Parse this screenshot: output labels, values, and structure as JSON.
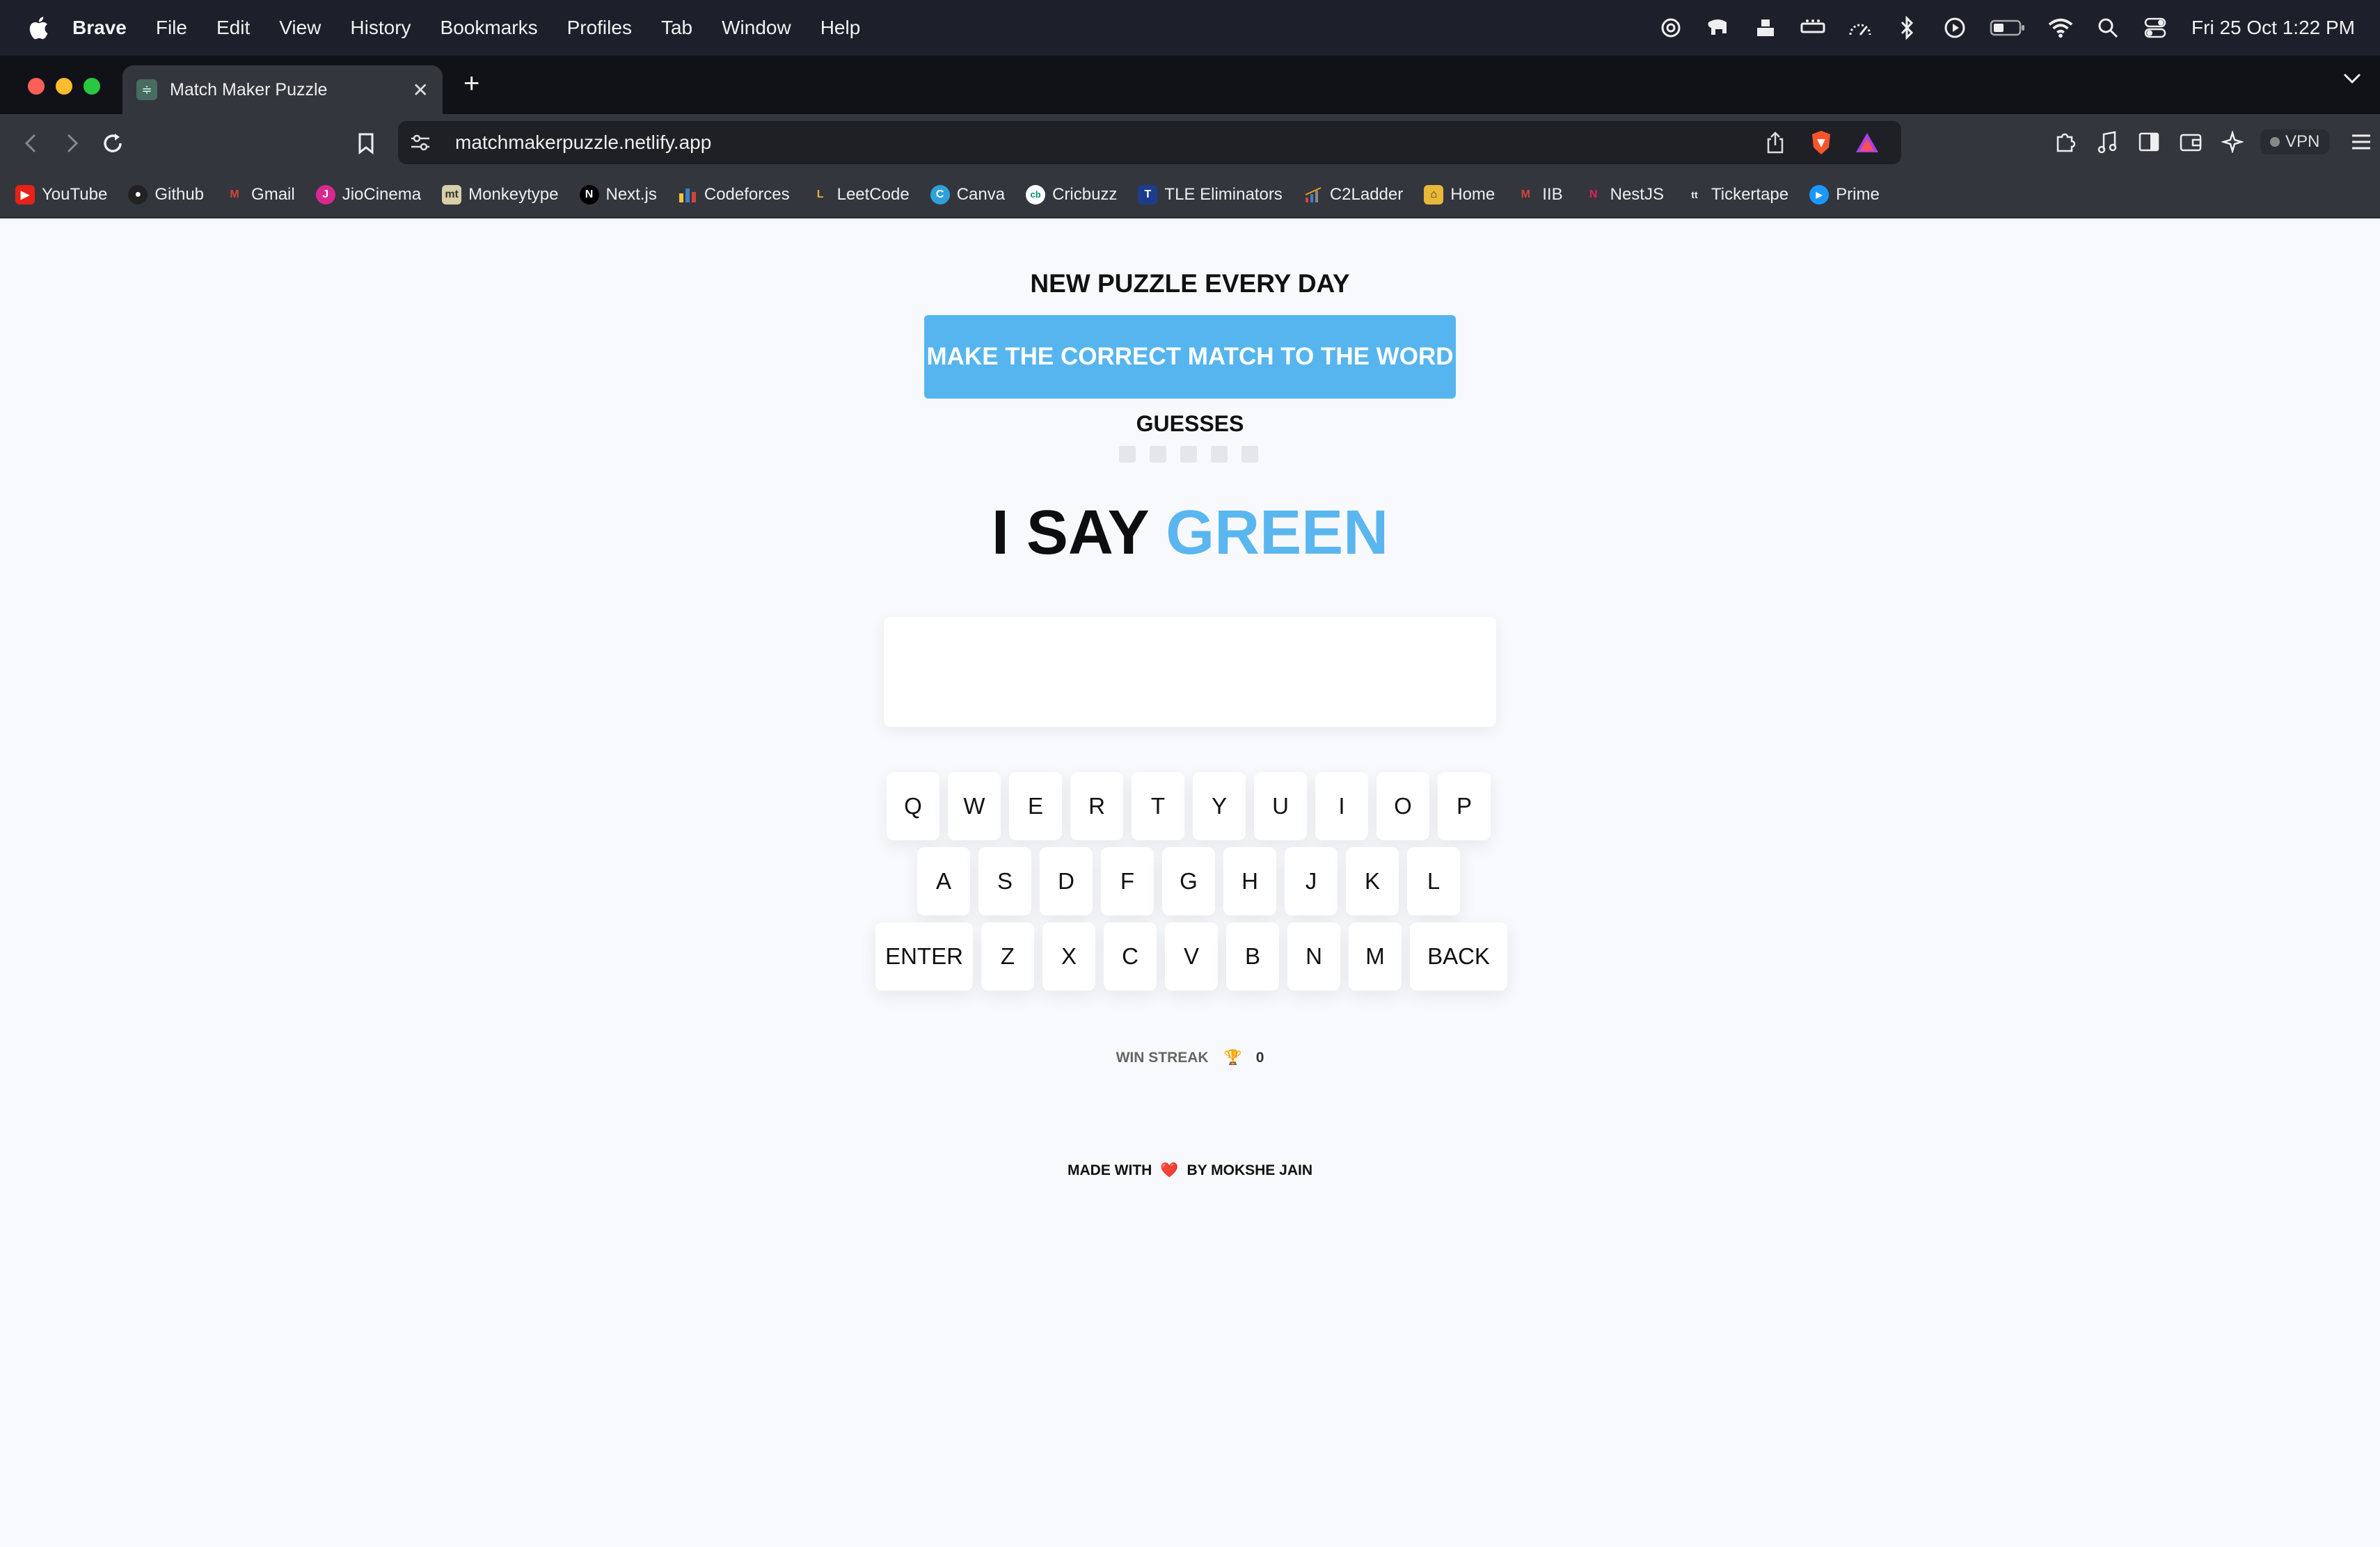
{
  "menubar": {
    "app_name": "Brave",
    "items": [
      "File",
      "Edit",
      "View",
      "History",
      "Bookmarks",
      "Profiles",
      "Tab",
      "Window",
      "Help"
    ],
    "clock": "Fri 25 Oct  1:22 PM"
  },
  "tab": {
    "title": "Match Maker Puzzle",
    "close_glyph": "✕",
    "new_tab_glyph": "+"
  },
  "toolbar": {
    "url": "matchmakerpuzzle.netlify.app",
    "vpn_label": "VPN"
  },
  "bookmarks": [
    {
      "label": "YouTube",
      "icon": "youtube-icon",
      "color": "#e62117",
      "glyph": "▶"
    },
    {
      "label": "Github",
      "icon": "github-icon",
      "color": "#222222",
      "glyph": "●"
    },
    {
      "label": "Gmail",
      "icon": "gmail-icon",
      "color": "#d44638",
      "glyph": "M"
    },
    {
      "label": "JioCinema",
      "icon": "jiocinema-icon",
      "color": "#d9288e",
      "glyph": "J"
    },
    {
      "label": "Monkeytype",
      "icon": "monkeytype-icon",
      "color": "#d8cfa8",
      "glyph": "mt"
    },
    {
      "label": "Next.js",
      "icon": "nextjs-icon",
      "color": "#000000",
      "glyph": "N"
    },
    {
      "label": "Codeforces",
      "icon": "codeforces-icon",
      "color": "#3b5998",
      "glyph": "▮"
    },
    {
      "label": "LeetCode",
      "icon": "leetcode-icon",
      "color": "#f0a93b",
      "glyph": "L"
    },
    {
      "label": "Canva",
      "icon": "canva-icon",
      "color": "#2ea1d8",
      "glyph": "C"
    },
    {
      "label": "Cricbuzz",
      "icon": "cricbuzz-icon",
      "color": "#009270",
      "glyph": "cb"
    },
    {
      "label": "TLE Eliminators",
      "icon": "tle-icon",
      "color": "#1c3d8c",
      "glyph": "T"
    },
    {
      "label": "C2Ladder",
      "icon": "c2ladder-icon",
      "color": "#555555",
      "glyph": "⟋"
    },
    {
      "label": "Home",
      "icon": "home-icon",
      "color": "#e8b83a",
      "glyph": "⌂"
    },
    {
      "label": "IIB",
      "icon": "iib-icon",
      "color": "#d44638",
      "glyph": "M"
    },
    {
      "label": "NestJS",
      "icon": "nestjs-icon",
      "color": "#e0234e",
      "glyph": "N"
    },
    {
      "label": "Tickertape",
      "icon": "tickertape-icon",
      "color": "#34363e",
      "glyph": "tt"
    },
    {
      "label": "Prime",
      "icon": "prime-icon",
      "color": "#1a98ff",
      "glyph": "▶"
    }
  ],
  "game": {
    "tagline": "NEW PUZZLE EVERY DAY",
    "instruction": "MAKE THE CORRECT MATCH TO THE WORD",
    "guesses_label": "GUESSES",
    "guesses_used": 0,
    "guesses_total": 5,
    "clue_prefix": "I SAY",
    "clue_word": "GREEN",
    "answer_value": "",
    "keyboard": {
      "row1": [
        "Q",
        "W",
        "E",
        "R",
        "T",
        "Y",
        "U",
        "I",
        "O",
        "P"
      ],
      "row2": [
        "A",
        "S",
        "D",
        "F",
        "G",
        "H",
        "J",
        "K",
        "L"
      ],
      "row3": [
        "ENTER",
        "Z",
        "X",
        "C",
        "V",
        "B",
        "N",
        "M",
        "BACK"
      ]
    },
    "streak_label": "WIN STREAK",
    "streak_count": "0",
    "trophy_glyph": "🏆"
  },
  "footer": {
    "prefix": "MADE WITH",
    "heart": "❤️",
    "suffix": "BY MOKSHE JAIN"
  },
  "colors": {
    "accent": "#56b5ee",
    "clue_word": "#5ab6ee",
    "page_bg": "#f8f9fc"
  }
}
